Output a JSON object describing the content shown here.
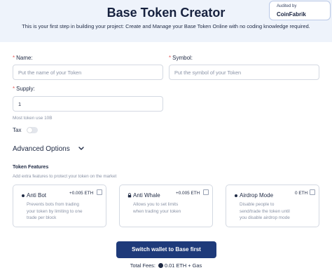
{
  "header": {
    "title": "Base Token Creator",
    "subtitle": "This is your first step in building your project: Create and Manage your Base Token Online with no coding knowledge required."
  },
  "audit": {
    "label": "Audited by",
    "name": "CoinFabrik"
  },
  "form": {
    "name": {
      "label": "Name:",
      "placeholder": "Put the name of your Token"
    },
    "symbol": {
      "label": "Symbol:",
      "placeholder": "Put the symbol of your Token"
    },
    "supply": {
      "label": "Supply:",
      "value": "1",
      "hint": "Most token use 10B"
    },
    "tax_label": "Tax",
    "tax_enabled": false
  },
  "advanced": {
    "label": "Advanced Options"
  },
  "features": {
    "title": "Token Features",
    "subtitle": "Add extra features to protect your token on the market",
    "cards": [
      {
        "title": "Anti Bot",
        "price": "+0.005 ETH",
        "icon": "dot-icon",
        "description": "Prevents bots from trading\nyour token by limiting to one\ntrade per block",
        "checked": false
      },
      {
        "title": "Anti Whale",
        "price": "+0.005 ETH",
        "icon": "lock-icon",
        "description": "Allows you to set limits\nwhen trading your token",
        "checked": false
      },
      {
        "title": "Airdrop Mode",
        "price": "0 ETH",
        "icon": "dot-icon",
        "description": "Disable people to\nsend/trade the token until\nyou disable airdrop mode",
        "checked": false
      }
    ]
  },
  "cta": {
    "label": "Switch wallet to Base first"
  },
  "fees": {
    "label": "Total Fees:",
    "value": "0.01 ETH + Gas"
  },
  "colors": {
    "primary": "#1e3a7a",
    "header_bg": "#eef3fb",
    "required": "#e35b5b"
  }
}
